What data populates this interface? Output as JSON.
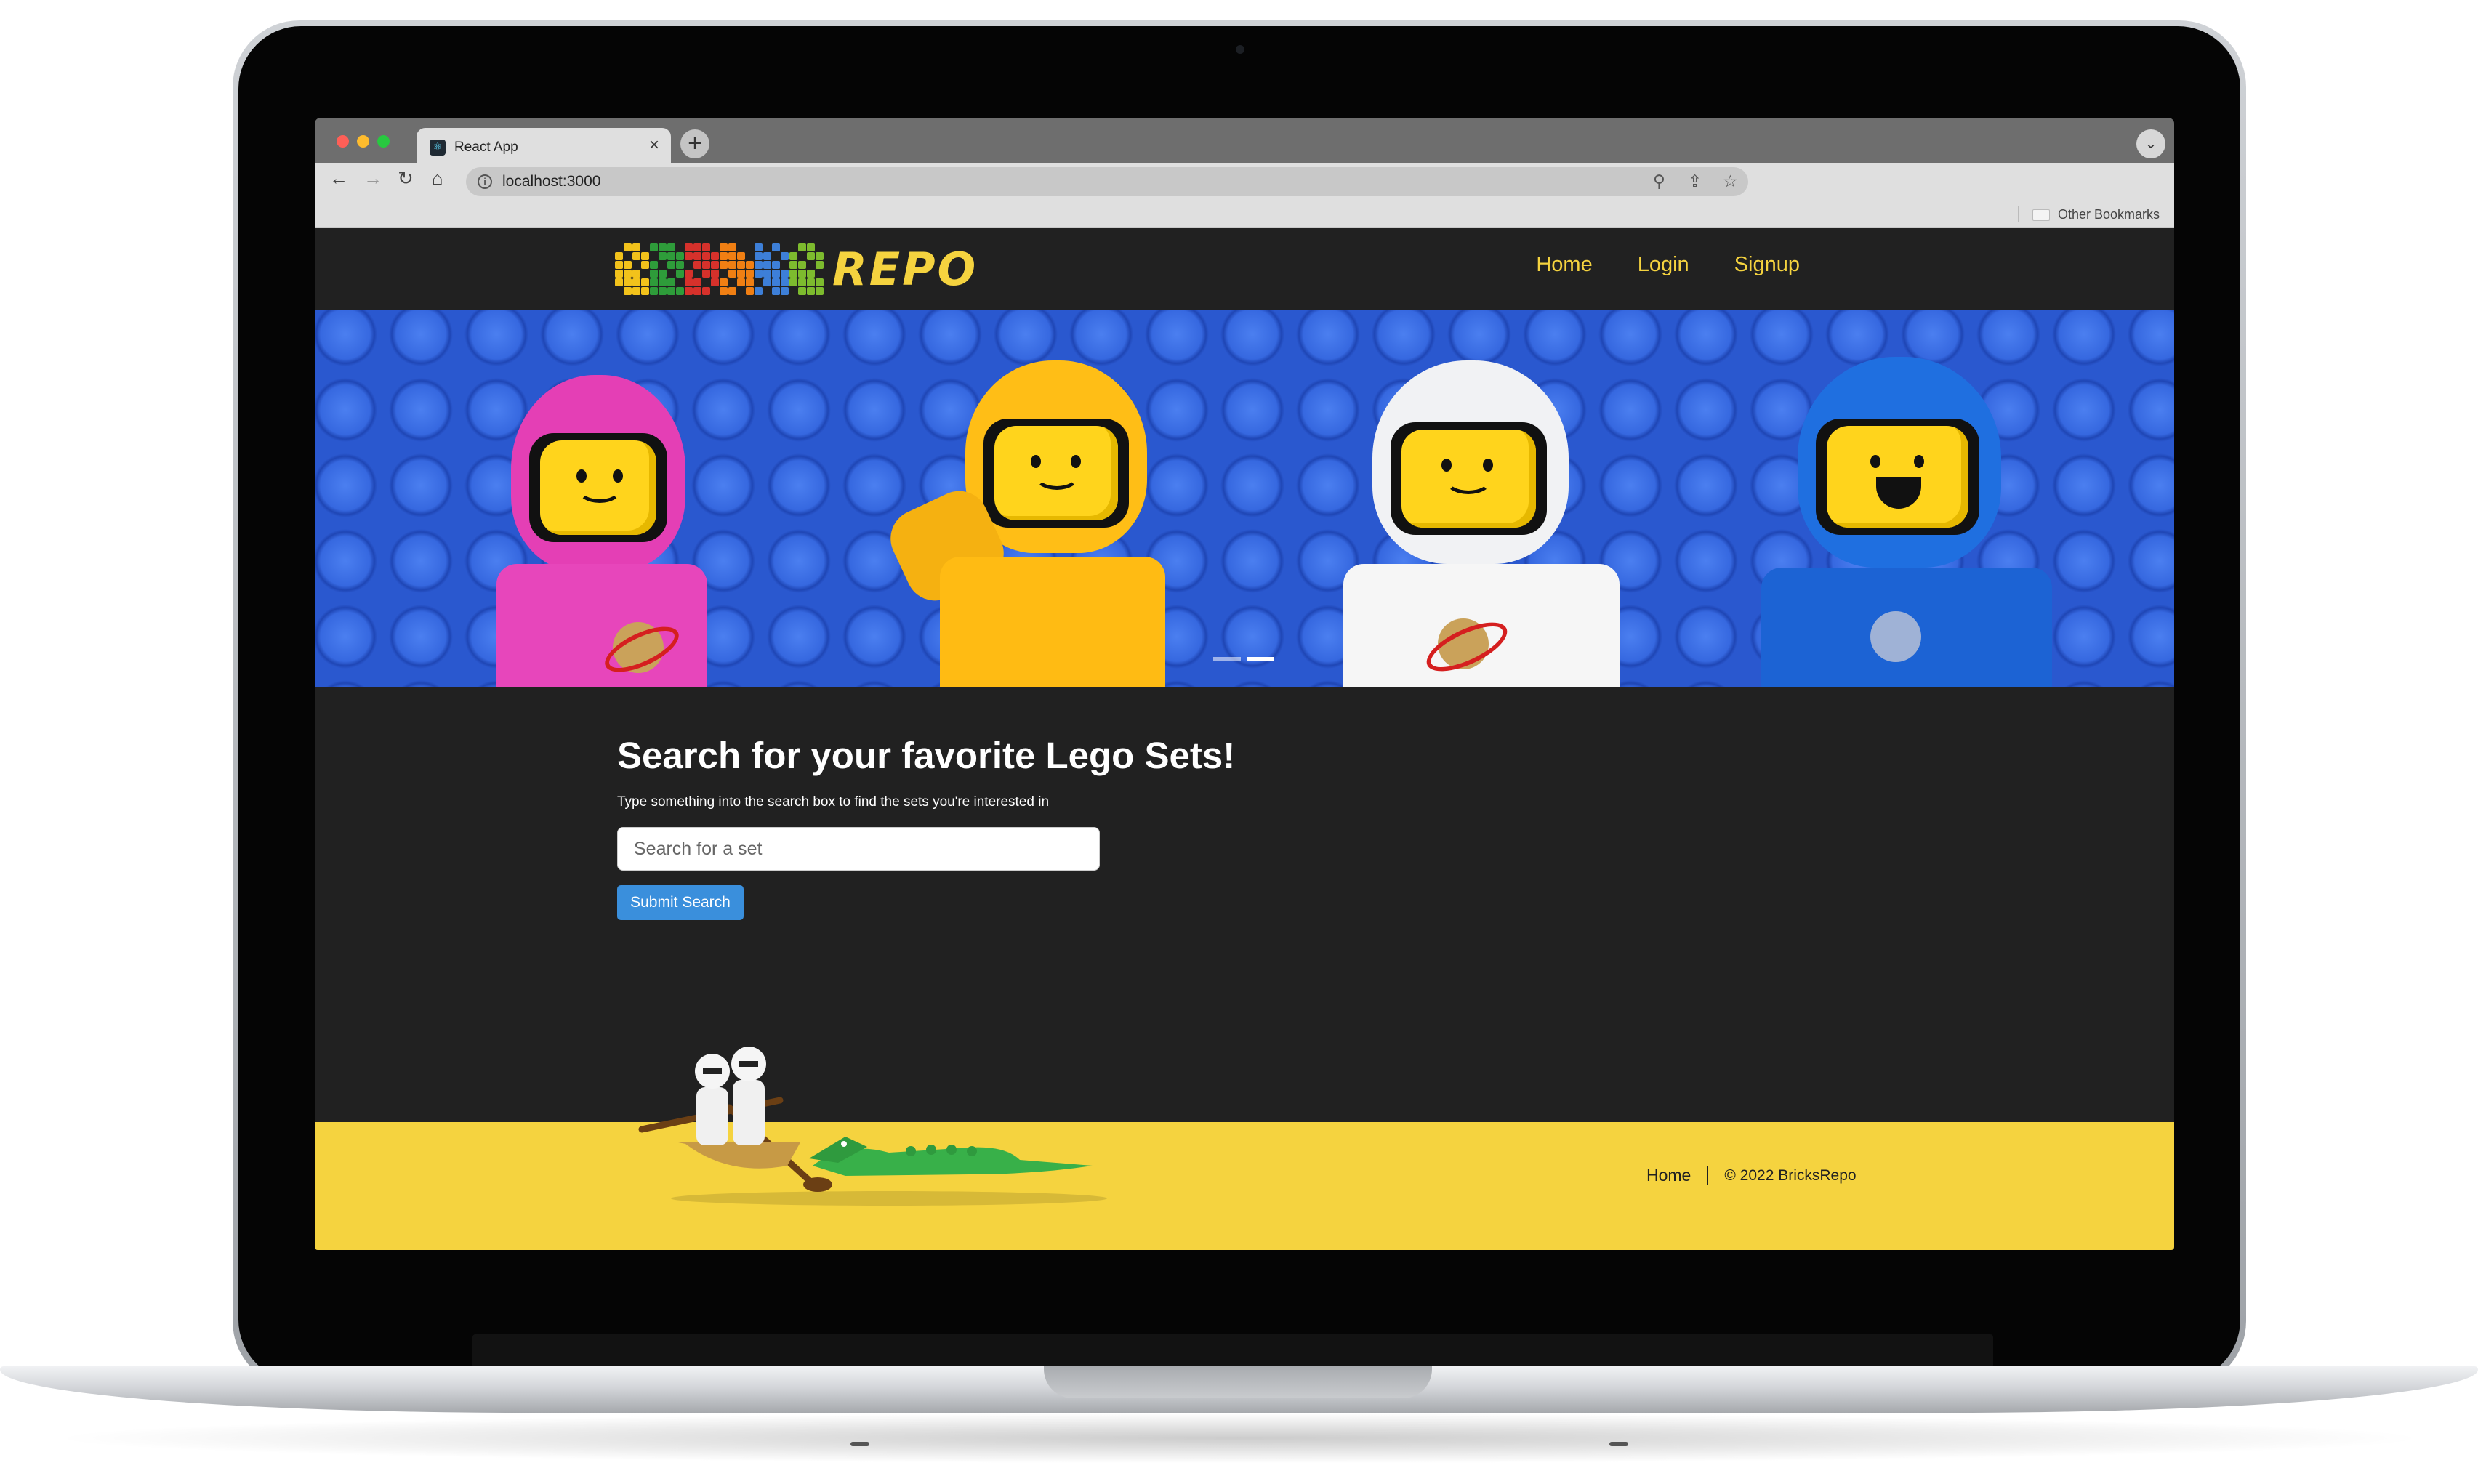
{
  "browser": {
    "tab_title": "React App",
    "tab_close": "×",
    "new_tab": "+",
    "url": "localhost:3000",
    "bookmarks_label": "Other Bookmarks"
  },
  "site": {
    "logo_text": "REPO",
    "brand_color": "#f5d33f",
    "nav": {
      "home": "Home",
      "login": "Login",
      "signup": "Signup"
    },
    "carousel": {
      "slide_count": 2,
      "active_slide": 2
    }
  },
  "search": {
    "heading": "Search for your favorite Lego Sets!",
    "subtext": "Type something into the search box to find the sets you're interested in",
    "placeholder": "Search for a set",
    "value": "",
    "submit_label": "Submit Search",
    "button_color": "#3a8fdc"
  },
  "footer": {
    "home_link": "Home",
    "copyright": "© 2022 BricksRepo"
  }
}
